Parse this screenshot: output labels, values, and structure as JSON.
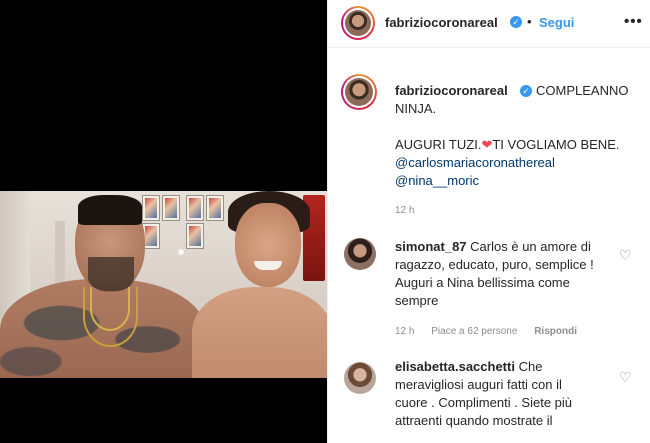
{
  "post": {
    "username": "fabriziocoronareal",
    "follow_label": "Segui",
    "more_label": "•••",
    "separator": "•"
  },
  "caption": {
    "username": "fabriziocoronareal",
    "line1": "COMPLEANNO",
    "line2": "NINJA.",
    "line3a": "AUGURI TUZI.",
    "heart": "❤",
    "line3b": "TI VOGLIAMO BENE.",
    "mention1": "@carlosmariacoronathereal",
    "mention2": "@nina__moric",
    "time": "12 h"
  },
  "comments": [
    {
      "username": "simonat_87",
      "text_lines": [
        "Carlos è un amore di",
        "ragazzo, educato, puro, semplice !",
        "Auguri a Nina bellissima come",
        "sempre"
      ],
      "time": "12 h",
      "likes": "Piace a 62 persone",
      "reply": "Rispondi"
    },
    {
      "username": "elisabetta.sacchetti",
      "text_lines": [
        "Che",
        "meravigliosi auguri fatti con il",
        "cuore . Complimenti . Siete più",
        "attraenti quando mostrate il"
      ]
    }
  ],
  "icons": {
    "verified": "✓",
    "like": "♡"
  },
  "colors": {
    "link": "#3897f0",
    "mention": "#00376b",
    "heart": "#ed4956",
    "muted": "#8e8e8e"
  }
}
